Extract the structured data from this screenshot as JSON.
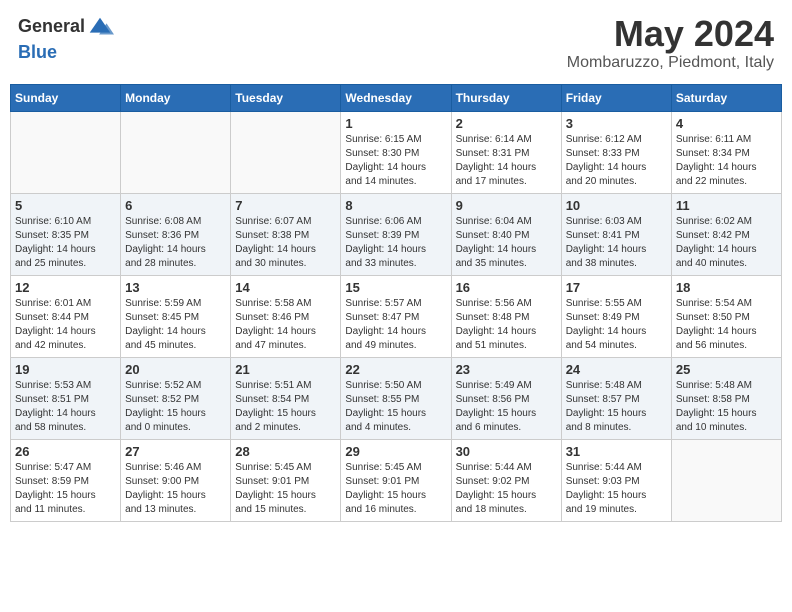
{
  "header": {
    "logo_line1": "General",
    "logo_line2": "Blue",
    "month": "May 2024",
    "location": "Mombaruzzo, Piedmont, Italy"
  },
  "days_of_week": [
    "Sunday",
    "Monday",
    "Tuesday",
    "Wednesday",
    "Thursday",
    "Friday",
    "Saturday"
  ],
  "weeks": [
    [
      {
        "day": "",
        "info": ""
      },
      {
        "day": "",
        "info": ""
      },
      {
        "day": "",
        "info": ""
      },
      {
        "day": "1",
        "info": "Sunrise: 6:15 AM\nSunset: 8:30 PM\nDaylight: 14 hours\nand 14 minutes."
      },
      {
        "day": "2",
        "info": "Sunrise: 6:14 AM\nSunset: 8:31 PM\nDaylight: 14 hours\nand 17 minutes."
      },
      {
        "day": "3",
        "info": "Sunrise: 6:12 AM\nSunset: 8:33 PM\nDaylight: 14 hours\nand 20 minutes."
      },
      {
        "day": "4",
        "info": "Sunrise: 6:11 AM\nSunset: 8:34 PM\nDaylight: 14 hours\nand 22 minutes."
      }
    ],
    [
      {
        "day": "5",
        "info": "Sunrise: 6:10 AM\nSunset: 8:35 PM\nDaylight: 14 hours\nand 25 minutes."
      },
      {
        "day": "6",
        "info": "Sunrise: 6:08 AM\nSunset: 8:36 PM\nDaylight: 14 hours\nand 28 minutes."
      },
      {
        "day": "7",
        "info": "Sunrise: 6:07 AM\nSunset: 8:38 PM\nDaylight: 14 hours\nand 30 minutes."
      },
      {
        "day": "8",
        "info": "Sunrise: 6:06 AM\nSunset: 8:39 PM\nDaylight: 14 hours\nand 33 minutes."
      },
      {
        "day": "9",
        "info": "Sunrise: 6:04 AM\nSunset: 8:40 PM\nDaylight: 14 hours\nand 35 minutes."
      },
      {
        "day": "10",
        "info": "Sunrise: 6:03 AM\nSunset: 8:41 PM\nDaylight: 14 hours\nand 38 minutes."
      },
      {
        "day": "11",
        "info": "Sunrise: 6:02 AM\nSunset: 8:42 PM\nDaylight: 14 hours\nand 40 minutes."
      }
    ],
    [
      {
        "day": "12",
        "info": "Sunrise: 6:01 AM\nSunset: 8:44 PM\nDaylight: 14 hours\nand 42 minutes."
      },
      {
        "day": "13",
        "info": "Sunrise: 5:59 AM\nSunset: 8:45 PM\nDaylight: 14 hours\nand 45 minutes."
      },
      {
        "day": "14",
        "info": "Sunrise: 5:58 AM\nSunset: 8:46 PM\nDaylight: 14 hours\nand 47 minutes."
      },
      {
        "day": "15",
        "info": "Sunrise: 5:57 AM\nSunset: 8:47 PM\nDaylight: 14 hours\nand 49 minutes."
      },
      {
        "day": "16",
        "info": "Sunrise: 5:56 AM\nSunset: 8:48 PM\nDaylight: 14 hours\nand 51 minutes."
      },
      {
        "day": "17",
        "info": "Sunrise: 5:55 AM\nSunset: 8:49 PM\nDaylight: 14 hours\nand 54 minutes."
      },
      {
        "day": "18",
        "info": "Sunrise: 5:54 AM\nSunset: 8:50 PM\nDaylight: 14 hours\nand 56 minutes."
      }
    ],
    [
      {
        "day": "19",
        "info": "Sunrise: 5:53 AM\nSunset: 8:51 PM\nDaylight: 14 hours\nand 58 minutes."
      },
      {
        "day": "20",
        "info": "Sunrise: 5:52 AM\nSunset: 8:52 PM\nDaylight: 15 hours\nand 0 minutes."
      },
      {
        "day": "21",
        "info": "Sunrise: 5:51 AM\nSunset: 8:54 PM\nDaylight: 15 hours\nand 2 minutes."
      },
      {
        "day": "22",
        "info": "Sunrise: 5:50 AM\nSunset: 8:55 PM\nDaylight: 15 hours\nand 4 minutes."
      },
      {
        "day": "23",
        "info": "Sunrise: 5:49 AM\nSunset: 8:56 PM\nDaylight: 15 hours\nand 6 minutes."
      },
      {
        "day": "24",
        "info": "Sunrise: 5:48 AM\nSunset: 8:57 PM\nDaylight: 15 hours\nand 8 minutes."
      },
      {
        "day": "25",
        "info": "Sunrise: 5:48 AM\nSunset: 8:58 PM\nDaylight: 15 hours\nand 10 minutes."
      }
    ],
    [
      {
        "day": "26",
        "info": "Sunrise: 5:47 AM\nSunset: 8:59 PM\nDaylight: 15 hours\nand 11 minutes."
      },
      {
        "day": "27",
        "info": "Sunrise: 5:46 AM\nSunset: 9:00 PM\nDaylight: 15 hours\nand 13 minutes."
      },
      {
        "day": "28",
        "info": "Sunrise: 5:45 AM\nSunset: 9:01 PM\nDaylight: 15 hours\nand 15 minutes."
      },
      {
        "day": "29",
        "info": "Sunrise: 5:45 AM\nSunset: 9:01 PM\nDaylight: 15 hours\nand 16 minutes."
      },
      {
        "day": "30",
        "info": "Sunrise: 5:44 AM\nSunset: 9:02 PM\nDaylight: 15 hours\nand 18 minutes."
      },
      {
        "day": "31",
        "info": "Sunrise: 5:44 AM\nSunset: 9:03 PM\nDaylight: 15 hours\nand 19 minutes."
      },
      {
        "day": "",
        "info": ""
      }
    ]
  ]
}
